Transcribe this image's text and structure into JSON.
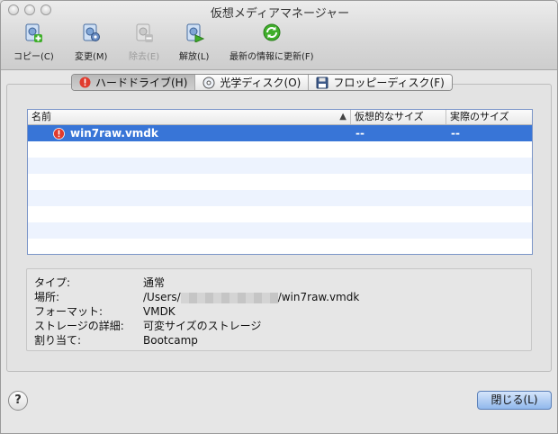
{
  "window": {
    "title": "仮想メディアマネージャー"
  },
  "toolbar": [
    {
      "id": "copy",
      "label": "コピー(C)",
      "icon": "disk-add-icon",
      "enabled": true
    },
    {
      "id": "modify",
      "label": "変更(M)",
      "icon": "disk-settings-icon",
      "enabled": true
    },
    {
      "id": "remove",
      "label": "除去(E)",
      "icon": "disk-remove-icon",
      "enabled": false
    },
    {
      "id": "release",
      "label": "解放(L)",
      "icon": "disk-release-icon",
      "enabled": true
    },
    {
      "id": "refresh",
      "label": "最新の情報に更新(F)",
      "icon": "refresh-icon",
      "enabled": true
    }
  ],
  "tabs": [
    {
      "label": "ハードドライブ(H)",
      "icon": "error-icon",
      "active": true
    },
    {
      "label": "光学ディスク(O)",
      "icon": "optical-disc-icon",
      "active": false
    },
    {
      "label": "フロッピーディスク(F)",
      "icon": "floppy-icon",
      "active": false
    }
  ],
  "table": {
    "columns": [
      "名前",
      "仮想的なサイズ",
      "実際のサイズ"
    ],
    "rows": [
      {
        "name": "win7raw.vmdk",
        "virtual_size": "--",
        "actual_size": "--",
        "selected": true,
        "icon": "error-icon"
      }
    ]
  },
  "details": {
    "type_label": "タイプ:",
    "type_value": "通常",
    "location_label": "場所:",
    "location_prefix": "/Users/",
    "location_suffix": "/win7raw.vmdk",
    "format_label": "フォーマット:",
    "format_value": "VMDK",
    "storage_label": "ストレージの詳細:",
    "storage_value": "可変サイズのストレージ",
    "attached_label": "割り当て:",
    "attached_value": "Bootcamp"
  },
  "footer": {
    "help_label": "?",
    "close_label": "閉じる(L)"
  },
  "colors": {
    "selection": "#3875d7",
    "error": "#e03b2e",
    "refresh": "#3fae2a"
  }
}
